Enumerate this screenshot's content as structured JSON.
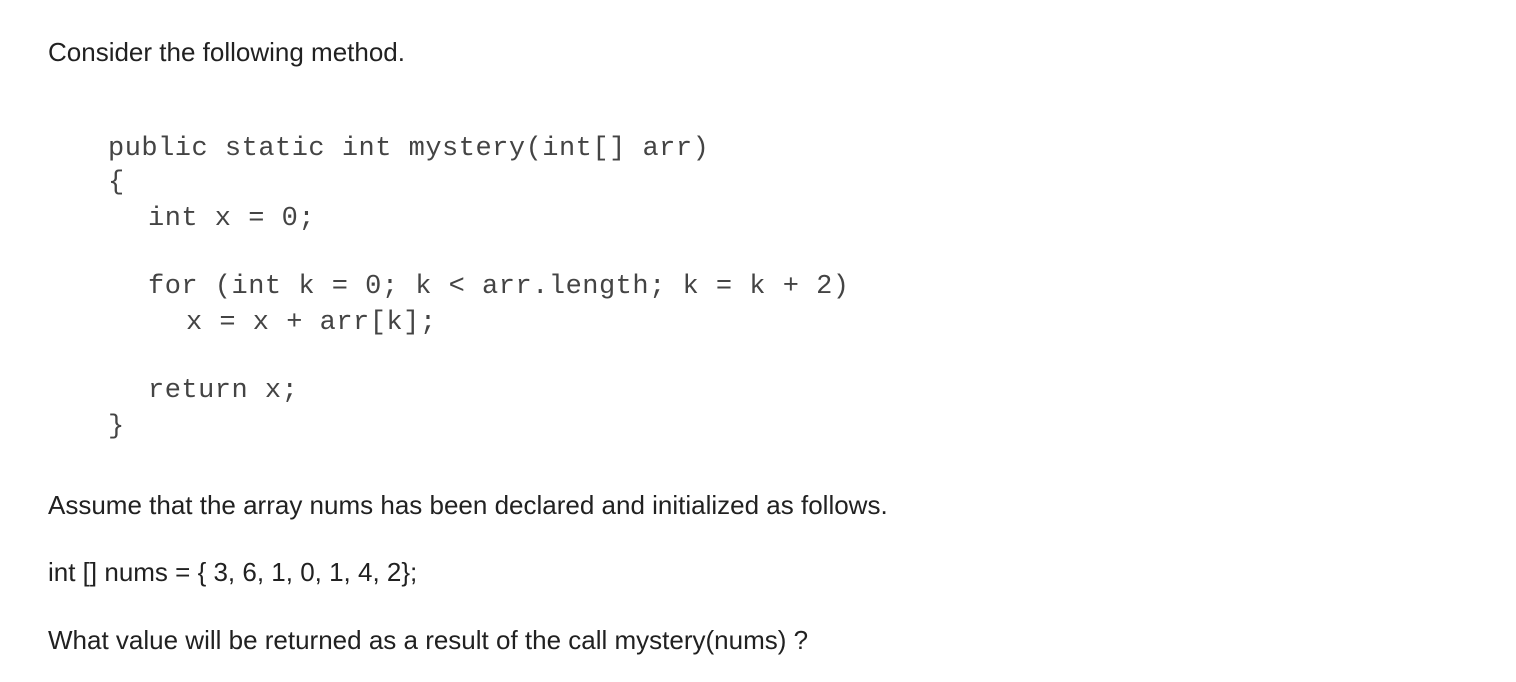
{
  "question": {
    "intro": "Consider the following method.",
    "code_lines": [
      "public static int mystery(int[] arr)",
      "{",
      "int x = 0;",
      "for (int k = 0; k < arr.length; k = k + 2)",
      "x = x + arr[k];",
      "return x;",
      "}"
    ],
    "assumption": "Assume that the array nums has been declared and initialized as follows.",
    "declaration": "int [] nums = { 3, 6, 1, 0, 1, 4, 2};",
    "prompt": "What value will be returned as a result of the call mystery(nums) ?"
  }
}
